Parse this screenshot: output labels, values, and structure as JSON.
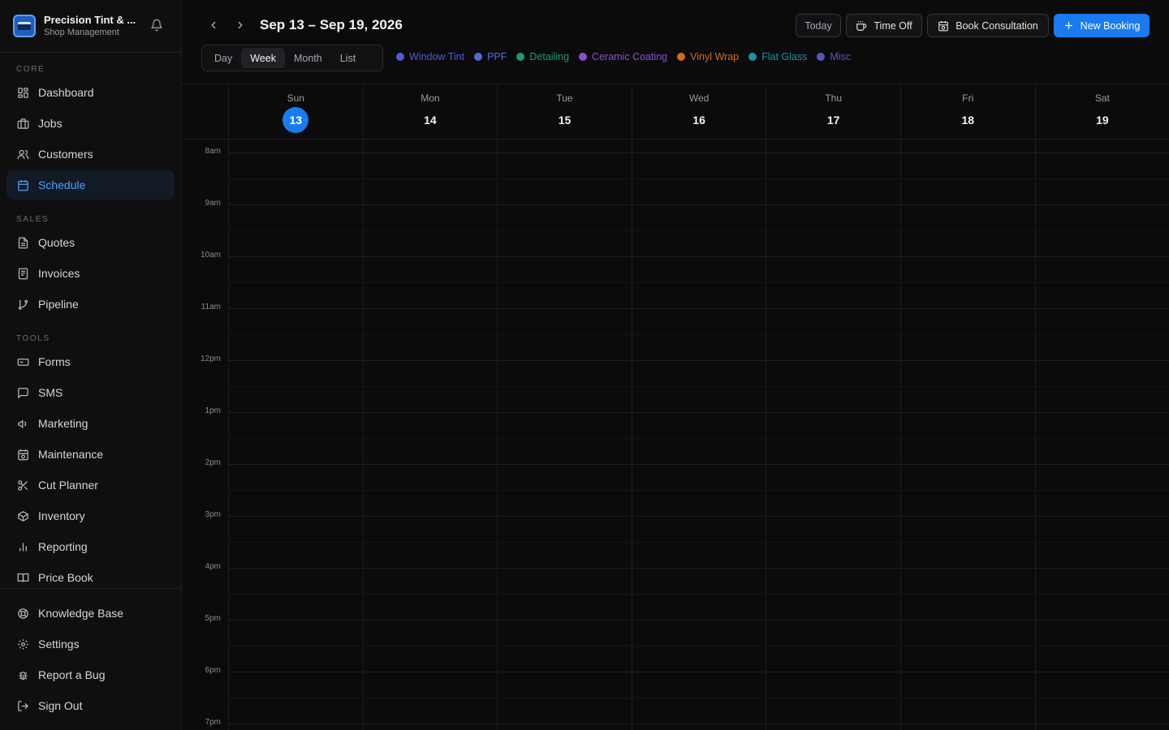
{
  "brand": {
    "title": "Precision Tint & ...",
    "subtitle": "Shop Management"
  },
  "sidebar": {
    "sections": {
      "core": "CORE",
      "sales": "SALES",
      "tools": "TOOLS"
    },
    "items": [
      {
        "label": "Dashboard",
        "icon": "dashboard-icon"
      },
      {
        "label": "Jobs",
        "icon": "briefcase-icon"
      },
      {
        "label": "Customers",
        "icon": "users-icon"
      },
      {
        "label": "Schedule",
        "icon": "calendar-icon",
        "active": true
      },
      {
        "label": "Quotes",
        "icon": "document-icon"
      },
      {
        "label": "Invoices",
        "icon": "receipt-icon"
      },
      {
        "label": "Pipeline",
        "icon": "git-branch-icon"
      },
      {
        "label": "Forms",
        "icon": "form-icon"
      },
      {
        "label": "SMS",
        "icon": "message-icon"
      },
      {
        "label": "Marketing",
        "icon": "megaphone-icon"
      },
      {
        "label": "Maintenance",
        "icon": "calendar-clock-icon"
      },
      {
        "label": "Cut Planner",
        "icon": "scissors-icon"
      },
      {
        "label": "Inventory",
        "icon": "box-icon"
      },
      {
        "label": "Reporting",
        "icon": "bar-chart-icon"
      },
      {
        "label": "Price Book",
        "icon": "book-icon"
      },
      {
        "label": "Knowledge Base",
        "icon": "lifebuoy-icon"
      },
      {
        "label": "Settings",
        "icon": "gear-icon"
      },
      {
        "label": "Report a Bug",
        "icon": "bug-icon"
      },
      {
        "label": "Sign Out",
        "icon": "sign-out-icon"
      }
    ]
  },
  "toolbar": {
    "date_range": "Sep 13 – Sep 19, 2026",
    "today_label": "Today",
    "time_off_label": "Time Off",
    "book_consultation_label": "Book Consultation",
    "new_booking_label": "New Booking"
  },
  "view_tabs": [
    {
      "label": "Day"
    },
    {
      "label": "Week",
      "active": true
    },
    {
      "label": "Month"
    },
    {
      "label": "List"
    }
  ],
  "legend": [
    {
      "label": "Window Tint",
      "color": "#4f5bd5"
    },
    {
      "label": "PPF",
      "color": "#4f6bd8"
    },
    {
      "label": "Detailing",
      "color": "#1f9a6a"
    },
    {
      "label": "Ceramic Coating",
      "color": "#8a4fd0"
    },
    {
      "label": "Vinyl Wrap",
      "color": "#d06a22"
    },
    {
      "label": "Flat Glass",
      "color": "#1f8fa8"
    },
    {
      "label": "Misc",
      "color": "#5a52c8"
    }
  ],
  "days": [
    {
      "name": "Sun",
      "num": "13",
      "today": true
    },
    {
      "name": "Mon",
      "num": "14"
    },
    {
      "name": "Tue",
      "num": "15"
    },
    {
      "name": "Wed",
      "num": "16"
    },
    {
      "name": "Thu",
      "num": "17"
    },
    {
      "name": "Fri",
      "num": "18"
    },
    {
      "name": "Sat",
      "num": "19"
    }
  ],
  "hours": [
    "8am",
    "9am",
    "10am",
    "11am",
    "12pm",
    "1pm",
    "2pm",
    "3pm",
    "4pm",
    "5pm",
    "6pm",
    "7pm"
  ],
  "colors": {
    "accent": "#1a7bf0",
    "active_nav_text": "#4ea3ff"
  }
}
